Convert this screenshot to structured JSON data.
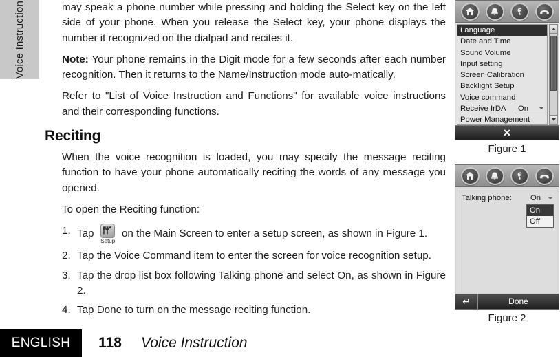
{
  "page": {
    "side_tab_label": "Voice Instruction",
    "paragraphs": {
      "intro": "may speak a phone number while pressing and holding the Select key on the left side of your phone. When you release the Select key, your phone displays the number it recognized on the dialpad and recites it.",
      "note_label": "Note:",
      "note_body": "Your phone remains in the Digit mode for a few seconds after each number recognition. Then it returns to the Name/Instruction mode auto-matically.",
      "refer": "Refer to \"List of Voice Instruction and Functions\" for available voice instructions and their corresponding functions."
    },
    "section": {
      "title": "Reciting",
      "body": "When the voice recognition is loaded, you may specify the message reciting function to have your phone automatically reciting the words of any message you opened.",
      "lead_in": "To open the Reciting function:"
    },
    "steps": [
      {
        "num": "1.",
        "before_icon": "Tap",
        "icon_caption": "Setup",
        "after_icon": "on the Main Screen to enter a setup screen, as shown in Figure 1."
      },
      {
        "num": "2.",
        "text": "Tap the Voice Command item to enter the screen for voice recognition setup."
      },
      {
        "num": "3.",
        "text": "Tap the drop list box following Talking phone and select On, as shown in Figure 2."
      },
      {
        "num": "4.",
        "text": "Tap Done to turn on the message reciting function."
      }
    ]
  },
  "figure1": {
    "caption": "Figure 1",
    "toolbar_icons": [
      "home-icon",
      "alarm-icon",
      "ear-icon",
      "handset-icon"
    ],
    "menu_items": [
      {
        "label": "Language",
        "selected": true
      },
      {
        "label": "Date and Time",
        "selected": false
      },
      {
        "label": "Sound Volume",
        "selected": false
      },
      {
        "label": "Input setting",
        "selected": false
      },
      {
        "label": "Screen Calibration",
        "selected": false
      },
      {
        "label": "Backlight Setup",
        "selected": false
      },
      {
        "label": "Voice command",
        "selected": false
      },
      {
        "label": "Receive IrDA",
        "selected": false,
        "value": "On"
      },
      {
        "label": "Power Management",
        "selected": false
      }
    ],
    "close_label": "✕"
  },
  "figure2": {
    "caption": "Figure 2",
    "toolbar_icons": [
      "home-icon",
      "alarm-icon",
      "ear-icon",
      "handset-icon"
    ],
    "field_label": "Talking phone:",
    "field_value": "On",
    "dropdown_options": [
      {
        "label": "On",
        "selected": true
      },
      {
        "label": "Off",
        "selected": false
      }
    ],
    "back_label": "↵",
    "done_label": "Done"
  },
  "footer": {
    "language": "ENGLISH",
    "page_number": "118",
    "chapter": "Voice Instruction"
  },
  "colors": {
    "side_tab_bg": "#c8c8c8",
    "footer_box_bg": "#000000",
    "selection_bg": "#2e2e2e",
    "device_bg": "#d9d9d9"
  }
}
